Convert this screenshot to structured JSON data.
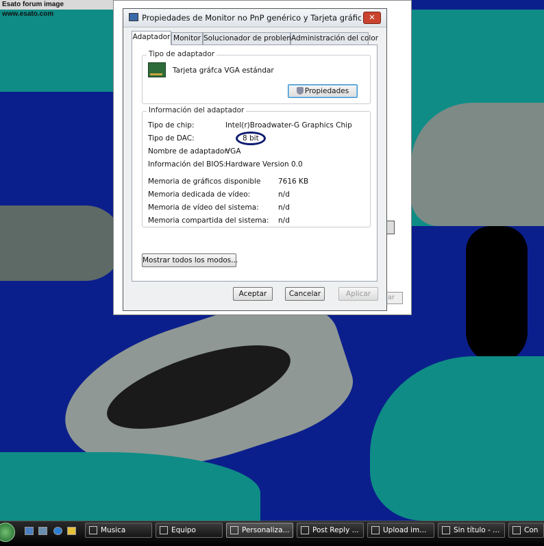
{
  "watermark": "Esato forum image www.esato.com",
  "dialog": {
    "title": "Propiedades de Monitor no PnP genérico y Tarjeta gráfica VGA e...",
    "close_label": "✕",
    "tabs": [
      "Adaptador",
      "Monitor",
      "Solucionador de problemas",
      "Administración del color"
    ],
    "adapter_type": {
      "legend": "Tipo de adaptador",
      "name": "Tarjeta gráfca VGA estándar",
      "properties_button": "Propiedades"
    },
    "adapter_info": {
      "legend": "Información del adaptador",
      "rows": [
        {
          "label": "Tipo de chip:",
          "value": "Intel(r)Broadwater-G Graphics Chip"
        },
        {
          "label": "Tipo de DAC:",
          "value": "8 bit"
        },
        {
          "label": "Nombre de adaptador:",
          "value": "VGA"
        },
        {
          "label": "Información del BIOS:",
          "value": "Hardware Version 0.0"
        }
      ],
      "memory_rows": [
        {
          "label": "Memoria de gráficos disponible",
          "value": "7616 KB"
        },
        {
          "label": "Memoria dedicada de vídeo:",
          "value": "n/d"
        },
        {
          "label": "Memoria de vídeo del sistema:",
          "value": "n/d"
        },
        {
          "label": "Memoria compartida del sistema:",
          "value": "n/d"
        }
      ]
    },
    "list_modes_button": "Mostrar todos los modos...",
    "ok_button": "Aceptar",
    "cancel_button": "Cancelar",
    "apply_button": "Aplicar"
  },
  "background_window": {
    "button_fragment": "lar"
  },
  "taskbar": {
    "buttons": [
      {
        "label": "Musica"
      },
      {
        "label": "Equipo"
      },
      {
        "label": "Personaliza..."
      },
      {
        "label": "Post Reply ..."
      },
      {
        "label": "Upload im..."
      },
      {
        "label": "Sin título - ..."
      },
      {
        "label": "Con"
      }
    ]
  },
  "colors": {
    "desktop_blue": "#0b1f8c",
    "teal": "#0f8c86",
    "highlight_circle": "#0c1a6e"
  }
}
